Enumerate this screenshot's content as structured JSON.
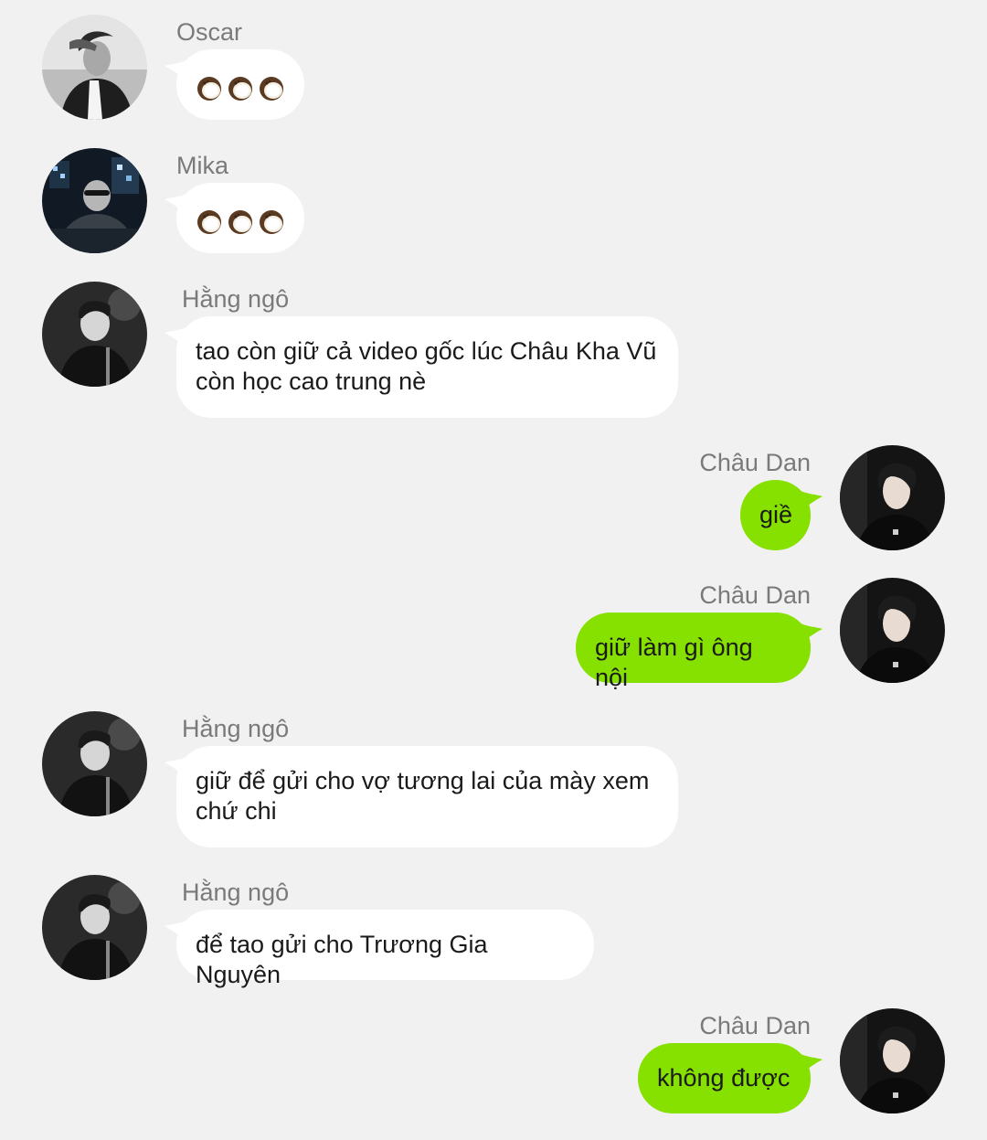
{
  "colors": {
    "background": "#f1f1f1",
    "incoming_bubble": "#ffffff",
    "outgoing_bubble": "#86e000",
    "sender_name": "#7a7a7a"
  },
  "messages": [
    {
      "side": "left",
      "sender": "Oscar",
      "avatar": "avatar-oscar",
      "content_icon": "coconut-emoji x3"
    },
    {
      "side": "left",
      "sender": "Mika",
      "avatar": "avatar-mika",
      "content_icon": "coconut-emoji x3"
    },
    {
      "side": "left",
      "sender": "Hằng ngô",
      "avatar": "avatar-hang-ngo",
      "lines": [
        "tao còn giữ cả video gốc lúc Châu Kha Vũ",
        "còn học cao trung nè"
      ]
    },
    {
      "side": "right",
      "sender": "Châu Dan",
      "avatar": "avatar-chau-dan",
      "lines": [
        "giề"
      ]
    },
    {
      "side": "right",
      "sender": "Châu Dan",
      "avatar": "avatar-chau-dan",
      "lines": [
        "giữ làm gì ông nội"
      ]
    },
    {
      "side": "left",
      "sender": "Hằng ngô",
      "avatar": "avatar-hang-ngo",
      "lines": [
        "giữ để gửi cho vợ tương lai của mày xem",
        "chứ chi"
      ]
    },
    {
      "side": "left",
      "sender": "Hằng ngô",
      "avatar": "avatar-hang-ngo",
      "lines": [
        "để tao gửi cho Trương Gia Nguyên"
      ]
    },
    {
      "side": "right",
      "sender": "Châu Dan",
      "avatar": "avatar-chau-dan",
      "lines": [
        "không được"
      ]
    }
  ]
}
